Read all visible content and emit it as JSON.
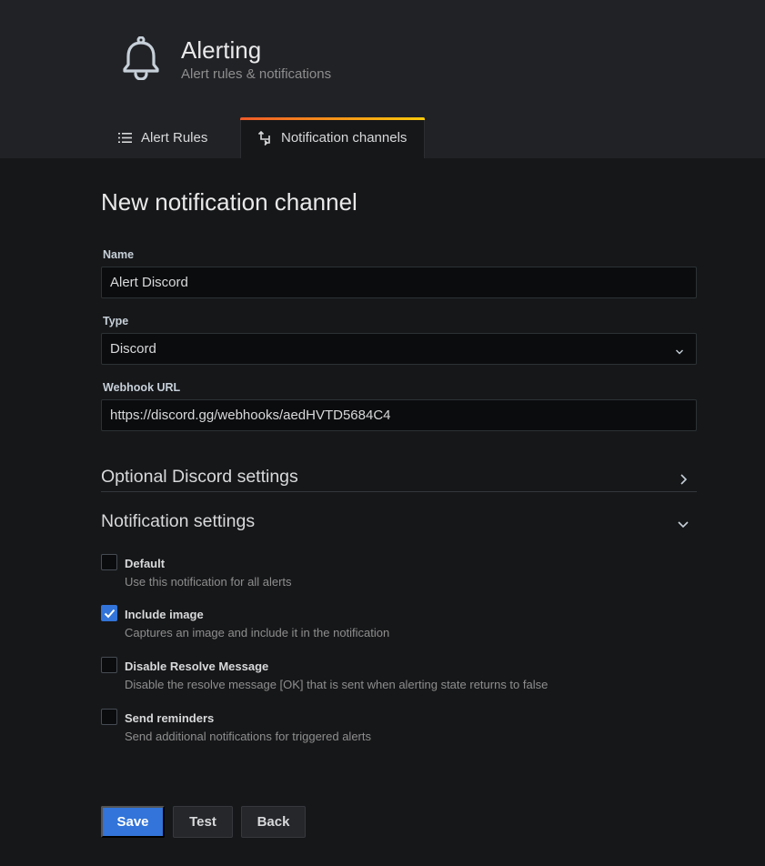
{
  "header": {
    "icon": "bell-icon",
    "title": "Alerting",
    "subtitle": "Alert rules & notifications"
  },
  "tabs": [
    {
      "label": "Alert Rules",
      "icon": "list-icon",
      "active": false
    },
    {
      "label": "Notification channels",
      "icon": "channel-arrow-icon",
      "active": true
    }
  ],
  "page_title": "New notification channel",
  "form": {
    "name": {
      "label": "Name",
      "value": "Alert Discord"
    },
    "type": {
      "label": "Type",
      "value": "Discord"
    },
    "webhook": {
      "label": "Webhook URL",
      "value": "https://discord.gg/webhooks/aedHVTD5684C4"
    }
  },
  "sections": {
    "optional": {
      "title": "Optional Discord settings",
      "expanded": false
    },
    "notification": {
      "title": "Notification settings",
      "expanded": true
    }
  },
  "checkboxes": [
    {
      "label": "Default",
      "description": "Use this notification for all alerts",
      "checked": false
    },
    {
      "label": "Include image",
      "description": "Captures an image and include it in the notification",
      "checked": true
    },
    {
      "label": "Disable Resolve Message",
      "description": "Disable the resolve message [OK] that is sent when alerting state returns to false",
      "checked": false
    },
    {
      "label": "Send reminders",
      "description": "Send additional notifications for triggered alerts",
      "checked": false
    }
  ],
  "buttons": {
    "save": "Save",
    "test": "Test",
    "back": "Back"
  },
  "colors": {
    "primary": "#3274d9",
    "background": "#161719",
    "header_bg": "#212226",
    "tab_accent_start": "#f05a28",
    "tab_accent_end": "#fbca0a"
  }
}
